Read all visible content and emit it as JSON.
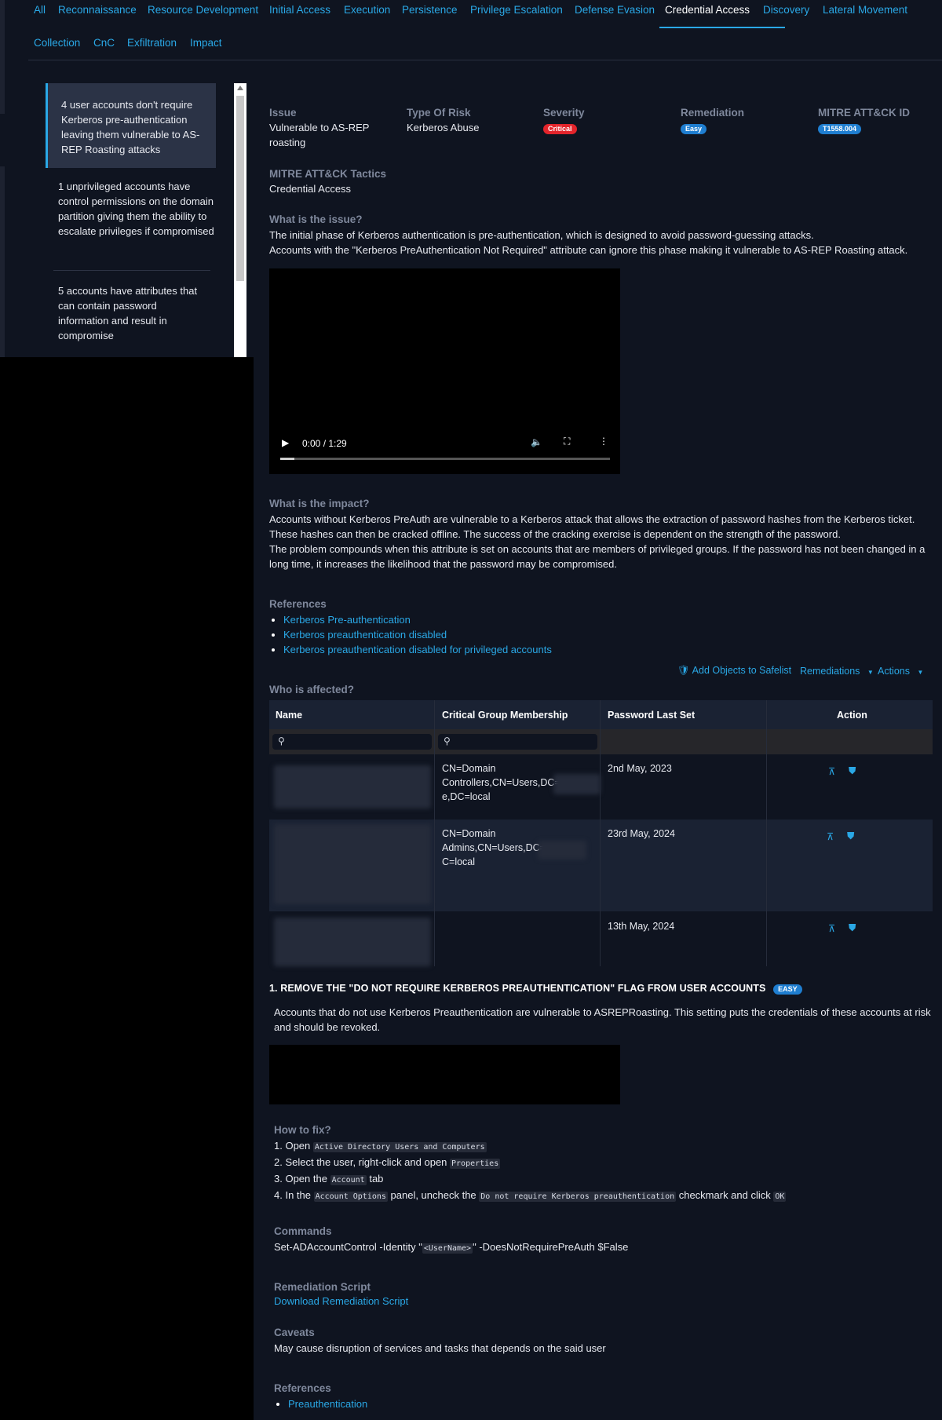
{
  "tabs": [
    {
      "label": "All"
    },
    {
      "label": "Reconnaissance"
    },
    {
      "label": "Resource Development"
    },
    {
      "label": "Initial Access"
    },
    {
      "label": "Execution"
    },
    {
      "label": "Persistence"
    },
    {
      "label": "Privilege Escalation"
    },
    {
      "label": "Defense Evasion"
    },
    {
      "label": "Credential Access"
    },
    {
      "label": "Discovery"
    },
    {
      "label": "Lateral Movement"
    },
    {
      "label": "Collection"
    },
    {
      "label": "CnC"
    },
    {
      "label": "Exfiltration"
    },
    {
      "label": "Impact"
    }
  ],
  "active_tab": "Credential Access",
  "issues": [
    {
      "text": "4 user accounts don't require Kerberos pre-authentication leaving them vulnerable to AS-REP Roasting attacks"
    },
    {
      "text": "1 unprivileged accounts have control permissions on the domain partition giving them the ability to escalate privileges if compromised"
    },
    {
      "text": "5 accounts have attributes that can contain password information and result in compromise"
    }
  ],
  "detail": {
    "issue_label": "Issue",
    "issue_value": "Vulnerable to AS-REP roasting",
    "risk_label": "Type Of Risk",
    "risk_value": "Kerberos Abuse",
    "severity_label": "Severity",
    "severity_value": "Critical",
    "remediation_label": "Remediation",
    "remediation_value": "Easy",
    "mitre_id_label": "MITRE ATT&CK ID",
    "mitre_id_value": "T1558.004",
    "tactics_label": "MITRE ATT&CK Tactics",
    "tactics_value": "Credential Access",
    "what_issue_label": "What is the issue?",
    "what_issue_p1": "The initial phase of Kerberos authentication is pre-authentication, which is designed to avoid password-guessing attacks.",
    "what_issue_p2": "Accounts with the \"Kerberos PreAuthentication Not Required\" attribute can ignore this phase making it vulnerable to AS-REP Roasting attack.",
    "video_time": "0:00 / 1:29",
    "impact_label": "What is the impact?",
    "impact_p1": "Accounts without Kerberos PreAuth are vulnerable to a Kerberos attack that allows the extraction of password hashes from the Kerberos ticket. These hashes can then be cracked offline. The success of the cracking exercise is dependent on the strength of the password.",
    "impact_p2": "The problem compounds when this attribute is set on accounts that are members of privileged groups. If the password has not been changed in a long time, it increases the likelihood that the password may be compromised.",
    "references_label": "References",
    "references": [
      {
        "text": "Kerberos Pre-authentication"
      },
      {
        "text": "Kerberos preauthentication disabled"
      },
      {
        "text": "Kerberos preauthentication disabled for privileged accounts"
      }
    ],
    "add_safelist": "Add Objects to Safelist",
    "remediations_btn": "Remediations",
    "actions_btn": "Actions",
    "affected_label": "Who is affected?"
  },
  "table": {
    "columns": [
      "Name",
      "Critical Group Membership",
      "Password Last Set",
      "Action"
    ],
    "rows": [
      {
        "group": "CN=Domain Controllers,CN=Users,DC=",
        "group_tail": "e,DC=local",
        "pwd": "2nd May, 2023"
      },
      {
        "group": "CN=Domain Admins,CN=Users,DC=",
        "group_tail": "C=local",
        "pwd": "23rd May, 2024"
      },
      {
        "group": "",
        "group_tail": "",
        "pwd": "13th May, 2024"
      }
    ]
  },
  "remediation": {
    "title": "1. REMOVE THE \"DO NOT REQUIRE KERBEROS PREAUTHENTICATION\" FLAG FROM USER ACCOUNTS",
    "badge": "EASY",
    "desc": "Accounts that do not use Kerberos Preauthentication are vulnerable to ASREPRoasting. This setting puts the credentials of these accounts at risk and should be revoked.",
    "howto_label": "How to fix?",
    "step1_pre": "1. Open ",
    "step1_code": "Active Directory Users and Computers",
    "step2_pre": "2. Select the user, right-click and open ",
    "step2_code": "Properties",
    "step3_pre": "3. Open the ",
    "step3_code": "Account",
    "step3_post": " tab",
    "step4_pre": "4. In the ",
    "step4_code1": "Account Options",
    "step4_mid": " panel, uncheck the ",
    "step4_code2": "Do not require Kerberos preauthentication",
    "step4_mid2": " checkmark and click ",
    "step4_code3": "OK",
    "commands_label": "Commands",
    "cmd_pre": "Set-ADAccountControl -Identity \"",
    "cmd_code": "<UserName>",
    "cmd_post": "\" -DoesNotRequirePreAuth $False",
    "script_label": "Remediation Script",
    "script_link": "Download Remediation Script",
    "caveats_label": "Caveats",
    "caveats_value": "May cause disruption of services and tasks that depends on the said user",
    "refs_label": "References",
    "refs": [
      {
        "text": "Preauthentication"
      }
    ]
  }
}
